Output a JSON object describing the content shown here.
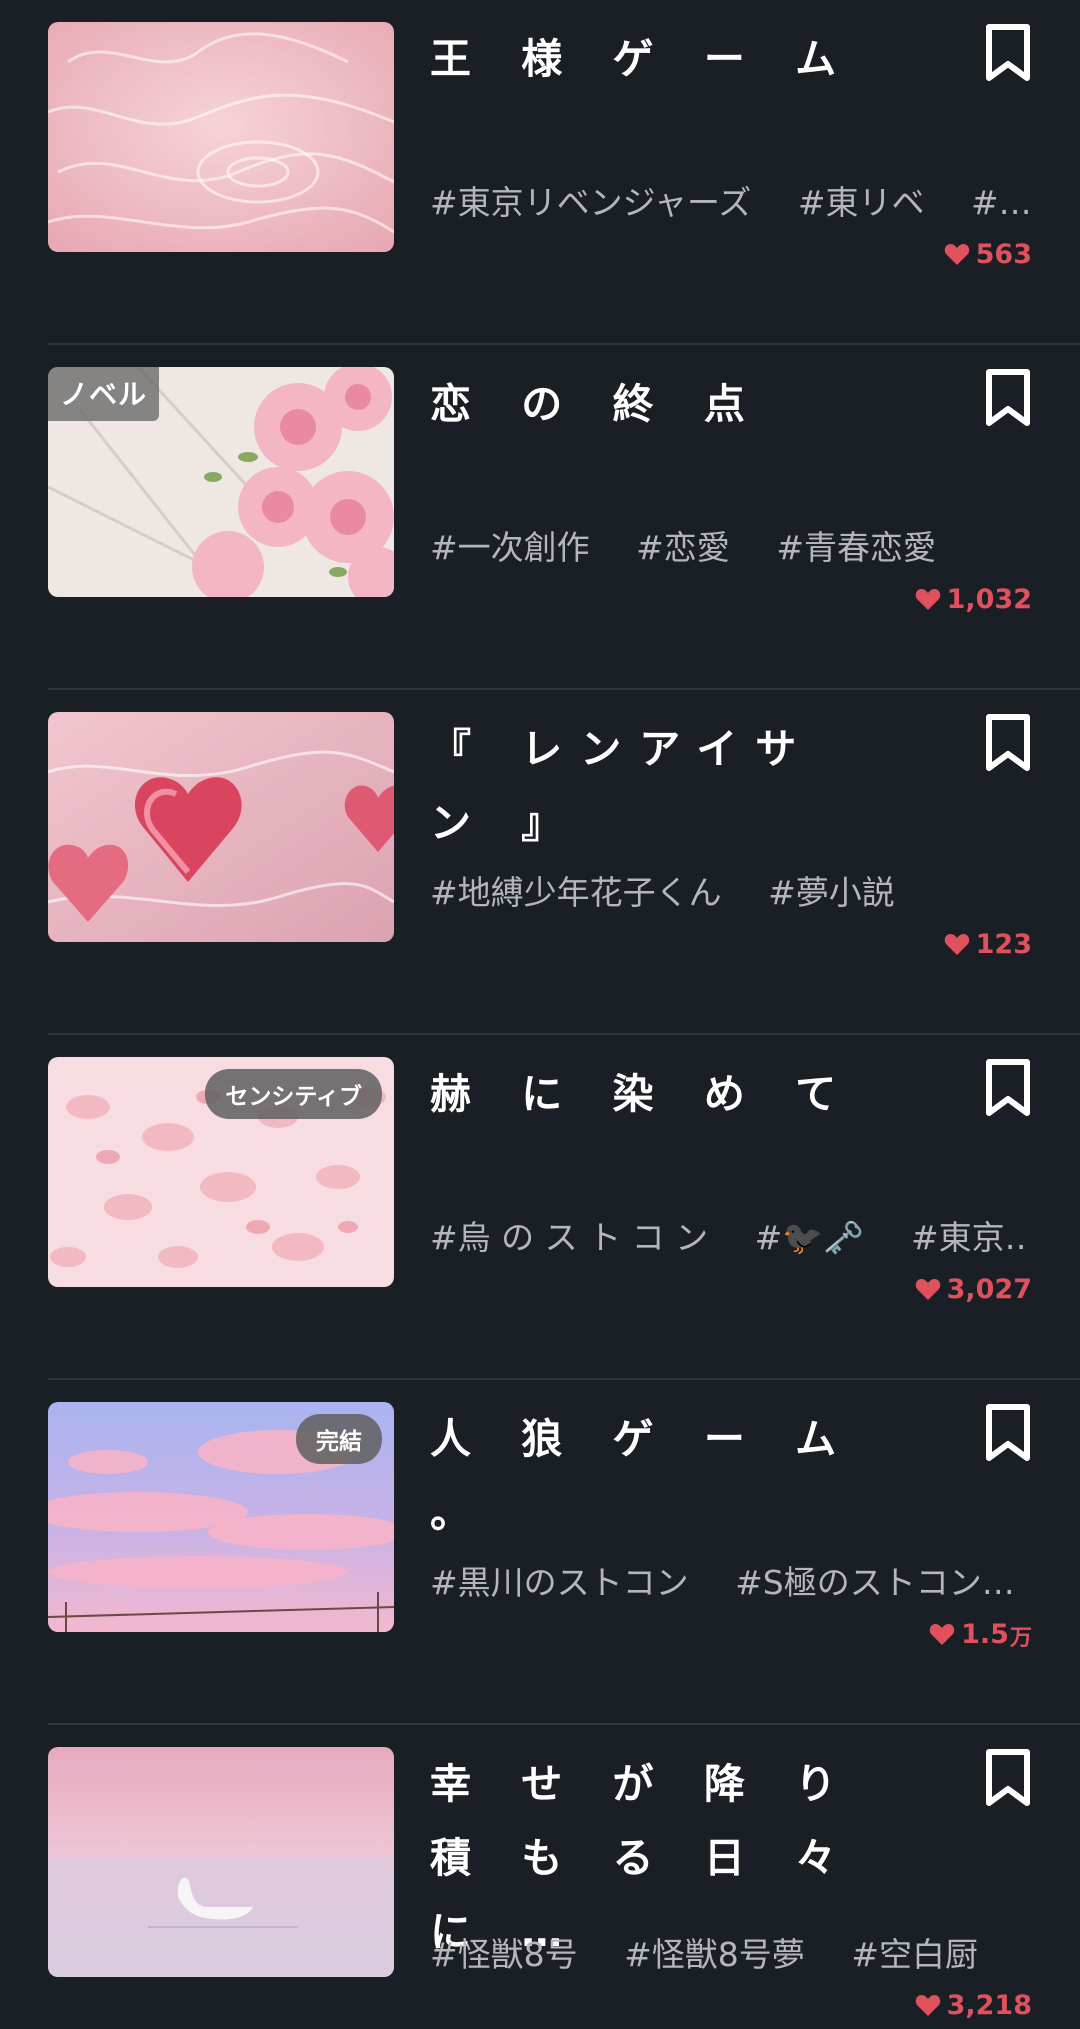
{
  "items": [
    {
      "title": "王 様 ゲ ー ム",
      "tags": [
        "#東京リベンジャーズ",
        "#東リベ",
        "#…"
      ],
      "likes": "563",
      "likes_unit": "",
      "label": "",
      "badge": "",
      "thumb_icon": "pink-water-ripple-image"
    },
    {
      "title": "恋 の 終 点",
      "tags": [
        "#一次創作",
        "#恋愛",
        "#青春恋愛"
      ],
      "likes": "1,032",
      "likes_unit": "",
      "label": "ノベル",
      "badge": "",
      "thumb_icon": "pink-roses-image"
    },
    {
      "title": "『 レンアイサン 』",
      "tags": [
        "#地縛少年花子くん",
        "#夢小説"
      ],
      "likes": "123",
      "likes_unit": "",
      "label": "",
      "badge": "",
      "thumb_icon": "pink-hearts-water-image"
    },
    {
      "title": "赫 に 染 め て",
      "tags": [
        "#烏 の ス ト コ ン",
        "#🐦‍⬛🗝️",
        "#東京…"
      ],
      "likes": "3,027",
      "likes_unit": "",
      "label": "",
      "badge": "センシティブ",
      "thumb_icon": "pink-petals-image"
    },
    {
      "title": "人 狼 ゲ ー ム 。",
      "tags": [
        "#黒川のストコン",
        "#S極のストコン…"
      ],
      "likes": "1.5",
      "likes_unit": "万",
      "label": "",
      "badge": "完結",
      "thumb_icon": "pink-sky-clouds-image"
    },
    {
      "title": "幸 せ が 降 り 積 も る 日 々 に …",
      "tags": [
        "#怪獣8号",
        "#怪獣8号夢",
        "#空白厨"
      ],
      "likes": "3,218",
      "likes_unit": "",
      "label": "",
      "badge": "",
      "thumb_icon": "swan-lake-image"
    }
  ],
  "colors": {
    "background": "#1a1e25",
    "like_red": "#e0515d",
    "tag_gray": "#b3b7bd",
    "divider": "#30353d"
  }
}
